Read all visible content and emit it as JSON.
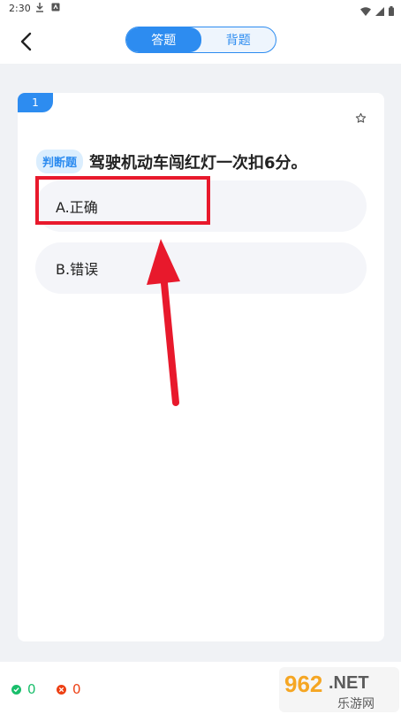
{
  "status_bar": {
    "time": "2:30"
  },
  "header": {
    "tabs": [
      {
        "label": "答题",
        "active": true
      },
      {
        "label": "背题",
        "active": false
      }
    ]
  },
  "question": {
    "number": "1",
    "type": "判断题",
    "text": "驾驶机动车闯红灯一次扣6分。",
    "options": [
      {
        "label": "A.正确"
      },
      {
        "label": "B.错误"
      }
    ]
  },
  "footer": {
    "correct_count": "0",
    "wrong_count": "0"
  },
  "watermark": {
    "number": "962",
    "suffix": ".NET",
    "text": "乐游网"
  },
  "colors": {
    "accent": "#2d8cf0",
    "annotation": "#e8192c",
    "correct": "#19be6b",
    "wrong": "#ed4014"
  }
}
